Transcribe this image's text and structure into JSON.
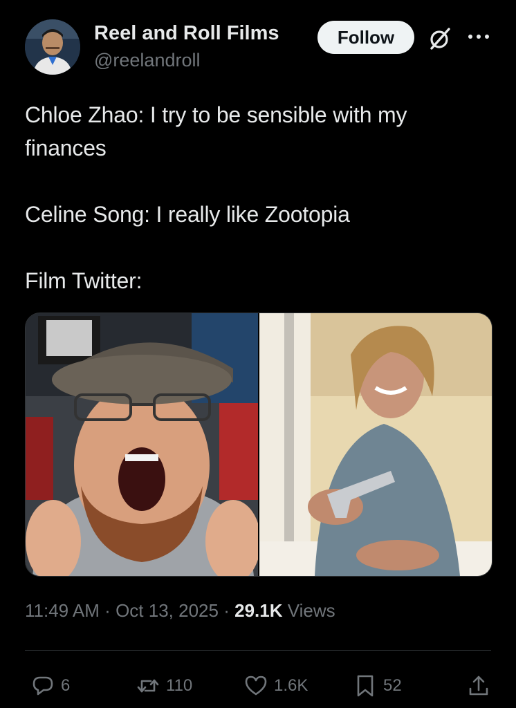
{
  "author": {
    "name": "Reel and Roll Films",
    "handle": "@reelandroll",
    "follow_label": "Follow"
  },
  "tweet": {
    "lines": [
      "Chloe Zhao: I try to be sensible with my finances",
      "Celine Song: I really like Zootopia",
      "Film Twitter:"
    ]
  },
  "meta": {
    "time": "11:49 AM",
    "date": "Oct 13, 2025",
    "separator": "·",
    "views_count": "29.1K",
    "views_label": "Views"
  },
  "actions": {
    "replies": "6",
    "reposts": "110",
    "likes": "1.6K",
    "bookmarks": "52"
  },
  "icons": {
    "grok": "grok-icon",
    "more": "more-icon",
    "reply": "reply-icon",
    "repost": "repost-icon",
    "like": "like-icon",
    "bookmark": "bookmark-icon",
    "share": "share-icon"
  },
  "colors": {
    "background": "#000000",
    "text": "#e7e9ea",
    "muted": "#71767b",
    "follow_bg": "#eff3f4",
    "divider": "#2f3336"
  }
}
